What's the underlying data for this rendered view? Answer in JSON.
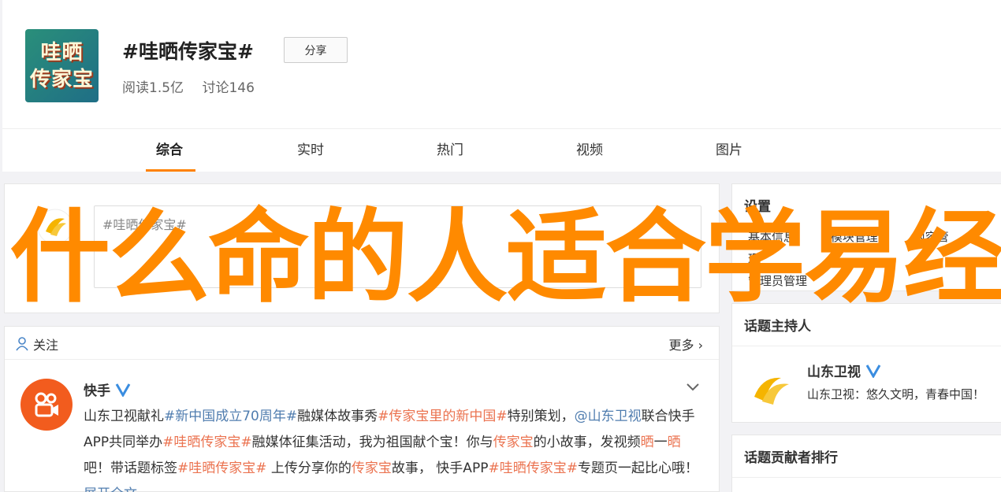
{
  "header": {
    "logo_line1": "哇晒",
    "logo_line2": "传家宝",
    "title": "#哇晒传家宝#",
    "share_label": "分享",
    "reads": "阅读1.5亿",
    "discussions": "讨论146"
  },
  "tabs": [
    "综合",
    "实时",
    "热门",
    "视频",
    "图片"
  ],
  "post_box": {
    "placeholder": "#哇晒传家宝#"
  },
  "feed": {
    "follow_label": "关注",
    "more_label": "更多",
    "author": "快手",
    "text_segments": [
      {
        "t": "山东卫视献礼",
        "c": "plain"
      },
      {
        "t": "#新中国成立70周年#",
        "c": "link"
      },
      {
        "t": "融媒体故事秀",
        "c": "plain"
      },
      {
        "t": "#传家宝里的新中国#",
        "c": "tag"
      },
      {
        "t": "特别策划，",
        "c": "plain"
      },
      {
        "t": "@山东卫视",
        "c": "link"
      },
      {
        "t": "联合快手APP共同举办",
        "c": "plain"
      },
      {
        "t": "#哇晒传家宝#",
        "c": "tag"
      },
      {
        "t": "融媒体征集活动，我为祖国献个宝！你与",
        "c": "plain"
      },
      {
        "t": "传家宝",
        "c": "tag"
      },
      {
        "t": "的小故事，发视频",
        "c": "plain"
      },
      {
        "t": "晒",
        "c": "tag"
      },
      {
        "t": "一",
        "c": "plain"
      },
      {
        "t": "晒",
        "c": "tag"
      },
      {
        "t": "吧！带话题标签",
        "c": "plain"
      },
      {
        "t": "#哇晒传家宝#",
        "c": "tag"
      },
      {
        "t": " 上传分享你的",
        "c": "plain"
      },
      {
        "t": "传家宝",
        "c": "tag"
      },
      {
        "t": "故事， 快手APP",
        "c": "plain"
      },
      {
        "t": "#哇晒传家宝#",
        "c": "tag"
      },
      {
        "t": "专题页一起比心哦！",
        "c": "plain"
      },
      {
        "t": " 展开全文",
        "c": "link"
      }
    ]
  },
  "sidebar": {
    "settings_title": "设置",
    "settings_links": [
      "基本信息",
      "模块管理",
      "内容管理",
      "管理员管理"
    ],
    "host_title": "话题主持人",
    "host_name": "山东卫视",
    "host_desc": "山东卫视：悠久文明，青春中国！",
    "contributors_title": "话题贡献者排行"
  },
  "overlay": {
    "text": "什么命的人适合学易经"
  },
  "colors": {
    "accent": "#ff8200",
    "overlay": "#ff8a00",
    "tag": "#eb7350",
    "link": "#507daf"
  }
}
